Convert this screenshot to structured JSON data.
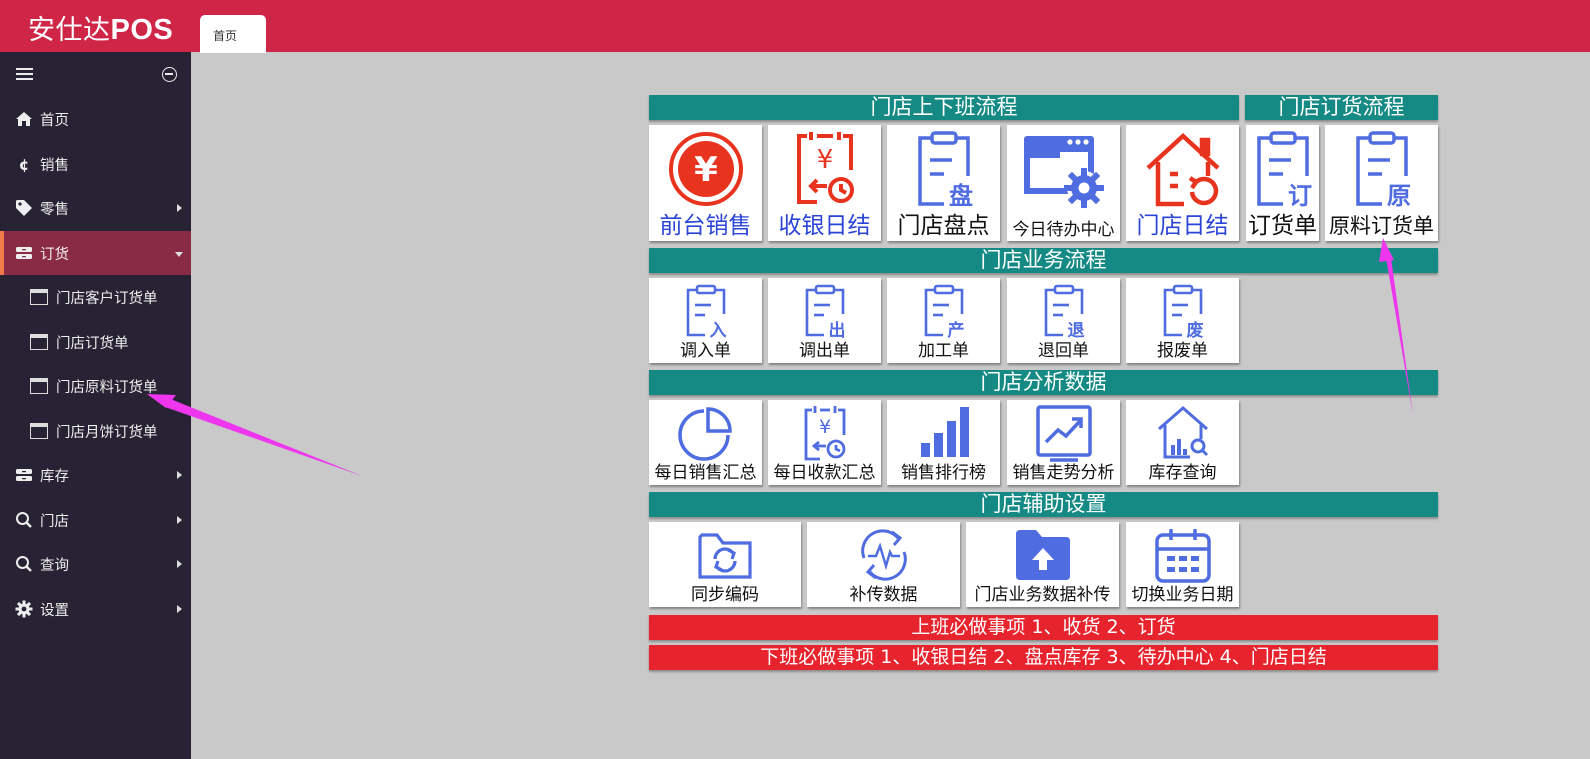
{
  "app": {
    "brand_cn": "安仕达",
    "brand_en": "POS"
  },
  "tabs": {
    "home": "首页"
  },
  "sidebar": {
    "items": [
      {
        "label": "首页",
        "icon": "home-icon"
      },
      {
        "label": "销售",
        "icon": "currency-icon"
      },
      {
        "label": "零售",
        "icon": "tag-icon"
      },
      {
        "label": "订货",
        "icon": "drawer-icon"
      },
      {
        "label": "门店客户订货单",
        "icon": "window-icon"
      },
      {
        "label": "门店订货单",
        "icon": "window-icon"
      },
      {
        "label": "门店原料订货单",
        "icon": "window-icon"
      },
      {
        "label": "门店月饼订货单",
        "icon": "window-icon"
      },
      {
        "label": "库存",
        "icon": "drawer-icon"
      },
      {
        "label": "门店",
        "icon": "search-icon"
      },
      {
        "label": "查询",
        "icon": "search-icon"
      },
      {
        "label": "设置",
        "icon": "gear-icon"
      }
    ]
  },
  "sections": {
    "shift_flow": "门店上下班流程",
    "order_flow": "门店订货流程",
    "business_flow": "门店业务流程",
    "analysis": "门店分析数据",
    "aux_settings": "门店辅助设置"
  },
  "tiles": {
    "front_sales": "前台销售",
    "cash_close": "收银日结",
    "inventory": "门店盘点",
    "todo_center": "今日待办中心",
    "store_close": "门店日结",
    "order_form": "订货单",
    "material_order": "原料订货单",
    "transfer_in": "调入单",
    "transfer_out": "调出单",
    "processing": "加工单",
    "return_form": "退回单",
    "scrap_form": "报废单",
    "daily_sales": "每日销售汇总",
    "daily_receipts": "每日收款汇总",
    "sales_rank": "销售排行榜",
    "sales_trend": "销售走势分析",
    "stock_query": "库存查询",
    "sync_codes": "同步编码",
    "resend_data": "补传数据",
    "store_data_resend": "门店业务数据补传",
    "switch_date": "切换业务日期"
  },
  "notices": {
    "on_shift": "上班必做事项 1、收货 2、订货",
    "off_shift": "下班必做事项 1、收银日结 2、盘点库存 3、待办中心 4、门店日结"
  },
  "colors": {
    "header": "#cf2648",
    "sidebar": "#282334",
    "section_bar": "#158a85",
    "notice": "#e7242e",
    "icon_blue": "#4f6ce0",
    "icon_red": "#e8331f",
    "annotation_arrow": "#ee36ee"
  }
}
